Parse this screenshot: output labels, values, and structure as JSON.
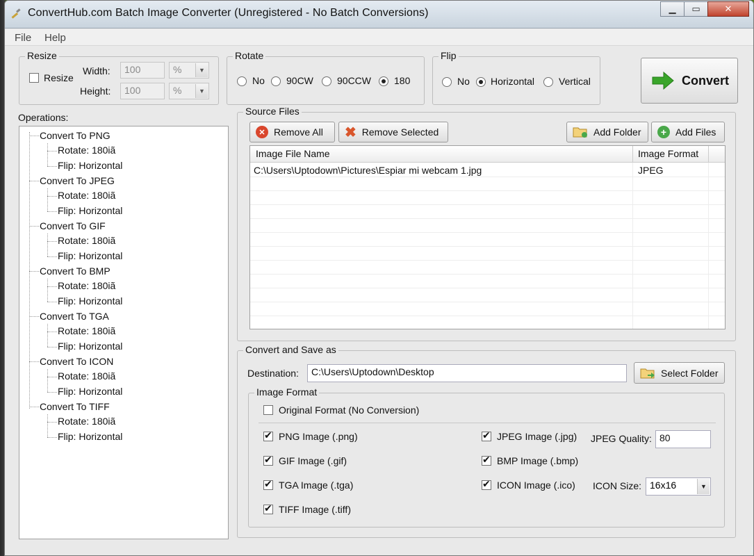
{
  "window": {
    "title": "ConvertHub.com Batch Image Converter (Unregistered - No Batch Conversions)",
    "caption_buttons": [
      "minimize-icon",
      "maximize-icon",
      "close-icon"
    ]
  },
  "menu": [
    "File",
    "Help"
  ],
  "resize": {
    "legend": "Resize",
    "checkbox_label": "Resize",
    "checked": false,
    "width_label": "Width:",
    "width_value": "100",
    "width_unit": "%",
    "height_label": "Height:",
    "height_value": "100",
    "height_unit": "%"
  },
  "rotate": {
    "legend": "Rotate",
    "options": [
      "No",
      "90CW",
      "90CCW",
      "180"
    ],
    "selected": "180"
  },
  "flip": {
    "legend": "Flip",
    "options": [
      "No",
      "Horizontal",
      "Vertical"
    ],
    "selected": "Horizontal"
  },
  "convert_button": {
    "label": "Convert",
    "icon": "arrow-right-icon",
    "color": "#3aa52a"
  },
  "operations": {
    "label": "Operations:",
    "items": [
      {
        "label": "Convert To PNG",
        "children": [
          "Rotate: 180iã",
          "Flip: Horizontal"
        ]
      },
      {
        "label": "Convert To JPEG",
        "children": [
          "Rotate: 180iã",
          "Flip: Horizontal"
        ]
      },
      {
        "label": "Convert To GIF",
        "children": [
          "Rotate: 180iã",
          "Flip: Horizontal"
        ]
      },
      {
        "label": "Convert To BMP",
        "children": [
          "Rotate: 180iã",
          "Flip: Horizontal"
        ]
      },
      {
        "label": "Convert To TGA",
        "children": [
          "Rotate: 180iã",
          "Flip: Horizontal"
        ]
      },
      {
        "label": "Convert To ICON",
        "children": [
          "Rotate: 180iã",
          "Flip: Horizontal"
        ]
      },
      {
        "label": "Convert To TIFF",
        "children": [
          "Rotate: 180iã",
          "Flip: Horizontal"
        ]
      }
    ]
  },
  "source_files": {
    "legend": "Source Files",
    "remove_all": "Remove All",
    "remove_selected": "Remove Selected",
    "add_folder": "Add Folder",
    "add_files": "Add Files",
    "columns": [
      "Image File Name",
      "Image Format"
    ],
    "rows": [
      [
        "C:\\Users\\Uptodown\\Pictures\\Espiar mi webcam 1.jpg",
        "JPEG"
      ]
    ]
  },
  "save": {
    "legend": "Convert and Save as",
    "destination_label": "Destination:",
    "destination_value": "C:\\Users\\Uptodown\\Desktop",
    "select_folder": "Select Folder"
  },
  "image_format": {
    "legend": "Image Format",
    "original": {
      "label": "Original Format (No Conversion)",
      "checked": false
    },
    "left": [
      {
        "label": "PNG Image (.png)",
        "checked": true
      },
      {
        "label": "GIF Image (.gif)",
        "checked": true
      },
      {
        "label": "TGA Image (.tga)",
        "checked": true
      },
      {
        "label": "TIFF Image (.tiff)",
        "checked": true
      }
    ],
    "right": [
      {
        "label": "JPEG Image (.jpg)",
        "checked": true
      },
      {
        "label": "BMP Image (.bmp)",
        "checked": true
      },
      {
        "label": "ICON Image (.ico)",
        "checked": true
      }
    ],
    "jpeg_quality_label": "JPEG Quality:",
    "jpeg_quality_value": "80",
    "icon_size_label": "ICON Size:",
    "icon_size_value": "16x16"
  }
}
